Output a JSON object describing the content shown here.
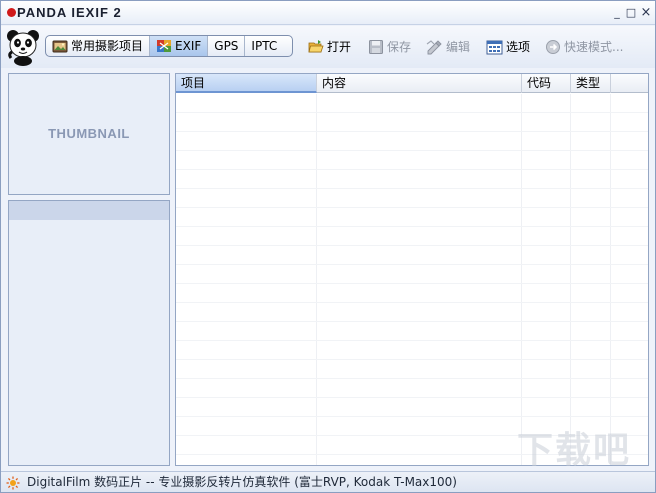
{
  "window": {
    "title": "PANDA IEXIF 2",
    "controls": {
      "minimize": "_",
      "maximize": "□",
      "close": "×"
    }
  },
  "toolbar": {
    "tabs": [
      {
        "label": "常用摄影项目",
        "icon": "camera-icon",
        "active": false
      },
      {
        "label": "EXIF",
        "icon": "exif-icon",
        "active": true
      },
      {
        "label": "GPS",
        "active": false
      },
      {
        "label": "IPTC",
        "active": false
      }
    ],
    "buttons": {
      "open": {
        "label": "打开",
        "icon": "folder-open-icon",
        "enabled": true
      },
      "save": {
        "label": "保存",
        "icon": "floppy-disk-icon",
        "enabled": false
      },
      "edit": {
        "label": "编辑",
        "icon": "edit-icon",
        "enabled": false
      },
      "options": {
        "label": "选项",
        "icon": "options-grid-icon",
        "enabled": true
      },
      "quick_mode": {
        "label": "快速模式...",
        "icon": "arrow-circle-icon",
        "enabled": false
      }
    }
  },
  "left_panel": {
    "thumbnail_label": "THUMBNAIL"
  },
  "grid": {
    "columns": [
      "项目",
      "内容",
      "代码",
      "类型"
    ],
    "selected_column": "项目",
    "rows": []
  },
  "statusbar": {
    "text": "DigitalFilm 数码正片 -- 专业摄影反转片仿真软件 (富士RVP, Kodak T-Max100)",
    "icon": "sun-icon"
  },
  "watermark": {
    "text": "下载吧"
  },
  "colors": {
    "window_bg": "#eef2fa",
    "panel_bg": "#e8eef8",
    "border": "#94a6c4",
    "active_tab": "#a9c6ec",
    "disabled_text": "#8f96a3"
  }
}
